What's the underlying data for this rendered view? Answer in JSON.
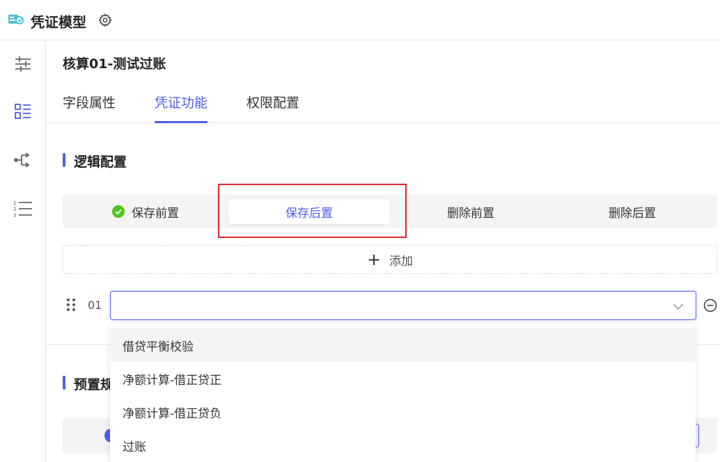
{
  "app": {
    "title": "凭证模型",
    "logo_icon": "document-code-icon",
    "settings_icon": "gear-icon"
  },
  "sidebar": {
    "items": [
      {
        "icon": "sliders-icon",
        "active": false
      },
      {
        "icon": "list-layout-icon",
        "active": true
      },
      {
        "icon": "flow-branch-icon",
        "active": false
      },
      {
        "icon": "numbered-list-icon",
        "active": false
      }
    ]
  },
  "page": {
    "title": "核算01-测试过账"
  },
  "tabs": [
    {
      "label": "字段属性",
      "active": false
    },
    {
      "label": "凭证功能",
      "active": true
    },
    {
      "label": "权限配置",
      "active": false
    }
  ],
  "logic_section": {
    "title": "逻辑配置",
    "segments": [
      {
        "label": "保存前置",
        "has_check": true,
        "active": false
      },
      {
        "label": "保存后置",
        "has_check": false,
        "active": true
      },
      {
        "label": "删除前置",
        "has_check": false,
        "active": false
      },
      {
        "label": "删除后置",
        "has_check": false,
        "active": false
      }
    ],
    "add_label": "添加",
    "rule": {
      "index": "01",
      "value": ""
    }
  },
  "dropdown": {
    "options": [
      "借贷平衡校验",
      "净额计算-借正贷正",
      "净额计算-借正贷负",
      "过账"
    ],
    "hovered_index": 0
  },
  "preset_section": {
    "title": "预置规"
  },
  "colors": {
    "accent": "#4d5ef0",
    "success": "#52c41a",
    "highlight": "#e0242a"
  }
}
